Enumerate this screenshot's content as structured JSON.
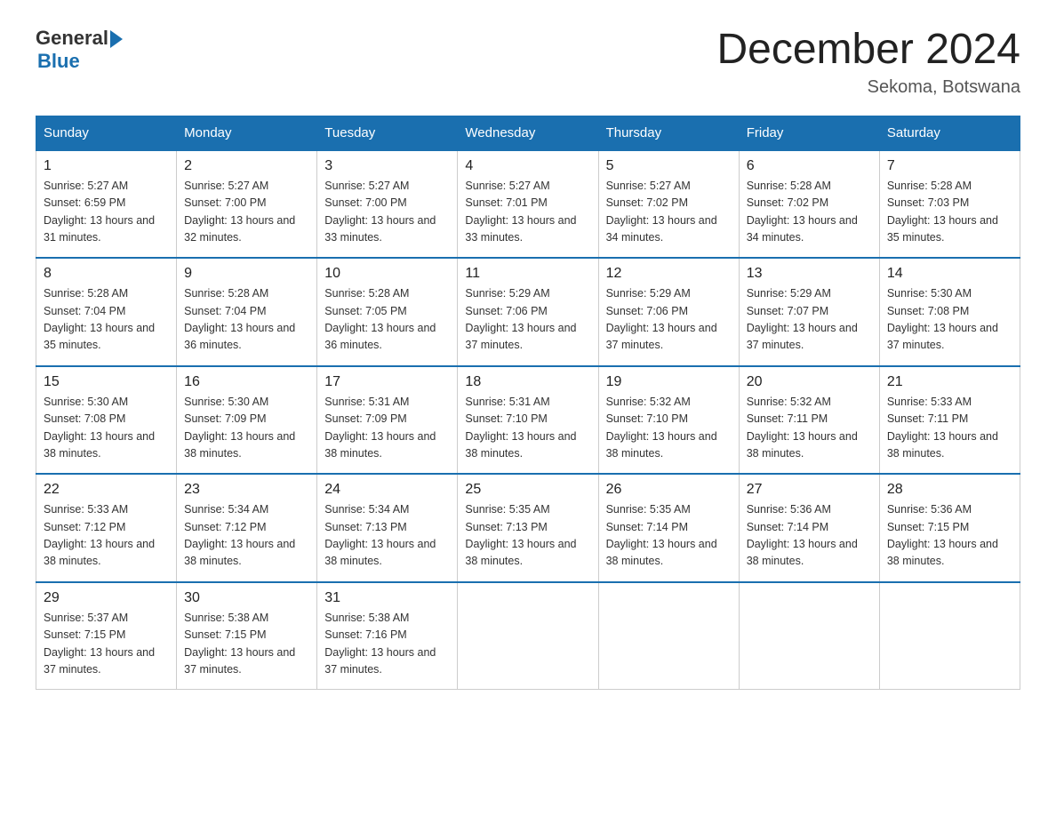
{
  "logo": {
    "text_general": "General",
    "text_blue": "Blue"
  },
  "title": "December 2024",
  "subtitle": "Sekoma, Botswana",
  "headers": [
    "Sunday",
    "Monday",
    "Tuesday",
    "Wednesday",
    "Thursday",
    "Friday",
    "Saturday"
  ],
  "weeks": [
    [
      {
        "day": "1",
        "sunrise": "5:27 AM",
        "sunset": "6:59 PM",
        "daylight": "13 hours and 31 minutes."
      },
      {
        "day": "2",
        "sunrise": "5:27 AM",
        "sunset": "7:00 PM",
        "daylight": "13 hours and 32 minutes."
      },
      {
        "day": "3",
        "sunrise": "5:27 AM",
        "sunset": "7:00 PM",
        "daylight": "13 hours and 33 minutes."
      },
      {
        "day": "4",
        "sunrise": "5:27 AM",
        "sunset": "7:01 PM",
        "daylight": "13 hours and 33 minutes."
      },
      {
        "day": "5",
        "sunrise": "5:27 AM",
        "sunset": "7:02 PM",
        "daylight": "13 hours and 34 minutes."
      },
      {
        "day": "6",
        "sunrise": "5:28 AM",
        "sunset": "7:02 PM",
        "daylight": "13 hours and 34 minutes."
      },
      {
        "day": "7",
        "sunrise": "5:28 AM",
        "sunset": "7:03 PM",
        "daylight": "13 hours and 35 minutes."
      }
    ],
    [
      {
        "day": "8",
        "sunrise": "5:28 AM",
        "sunset": "7:04 PM",
        "daylight": "13 hours and 35 minutes."
      },
      {
        "day": "9",
        "sunrise": "5:28 AM",
        "sunset": "7:04 PM",
        "daylight": "13 hours and 36 minutes."
      },
      {
        "day": "10",
        "sunrise": "5:28 AM",
        "sunset": "7:05 PM",
        "daylight": "13 hours and 36 minutes."
      },
      {
        "day": "11",
        "sunrise": "5:29 AM",
        "sunset": "7:06 PM",
        "daylight": "13 hours and 37 minutes."
      },
      {
        "day": "12",
        "sunrise": "5:29 AM",
        "sunset": "7:06 PM",
        "daylight": "13 hours and 37 minutes."
      },
      {
        "day": "13",
        "sunrise": "5:29 AM",
        "sunset": "7:07 PM",
        "daylight": "13 hours and 37 minutes."
      },
      {
        "day": "14",
        "sunrise": "5:30 AM",
        "sunset": "7:08 PM",
        "daylight": "13 hours and 37 minutes."
      }
    ],
    [
      {
        "day": "15",
        "sunrise": "5:30 AM",
        "sunset": "7:08 PM",
        "daylight": "13 hours and 38 minutes."
      },
      {
        "day": "16",
        "sunrise": "5:30 AM",
        "sunset": "7:09 PM",
        "daylight": "13 hours and 38 minutes."
      },
      {
        "day": "17",
        "sunrise": "5:31 AM",
        "sunset": "7:09 PM",
        "daylight": "13 hours and 38 minutes."
      },
      {
        "day": "18",
        "sunrise": "5:31 AM",
        "sunset": "7:10 PM",
        "daylight": "13 hours and 38 minutes."
      },
      {
        "day": "19",
        "sunrise": "5:32 AM",
        "sunset": "7:10 PM",
        "daylight": "13 hours and 38 minutes."
      },
      {
        "day": "20",
        "sunrise": "5:32 AM",
        "sunset": "7:11 PM",
        "daylight": "13 hours and 38 minutes."
      },
      {
        "day": "21",
        "sunrise": "5:33 AM",
        "sunset": "7:11 PM",
        "daylight": "13 hours and 38 minutes."
      }
    ],
    [
      {
        "day": "22",
        "sunrise": "5:33 AM",
        "sunset": "7:12 PM",
        "daylight": "13 hours and 38 minutes."
      },
      {
        "day": "23",
        "sunrise": "5:34 AM",
        "sunset": "7:12 PM",
        "daylight": "13 hours and 38 minutes."
      },
      {
        "day": "24",
        "sunrise": "5:34 AM",
        "sunset": "7:13 PM",
        "daylight": "13 hours and 38 minutes."
      },
      {
        "day": "25",
        "sunrise": "5:35 AM",
        "sunset": "7:13 PM",
        "daylight": "13 hours and 38 minutes."
      },
      {
        "day": "26",
        "sunrise": "5:35 AM",
        "sunset": "7:14 PM",
        "daylight": "13 hours and 38 minutes."
      },
      {
        "day": "27",
        "sunrise": "5:36 AM",
        "sunset": "7:14 PM",
        "daylight": "13 hours and 38 minutes."
      },
      {
        "day": "28",
        "sunrise": "5:36 AM",
        "sunset": "7:15 PM",
        "daylight": "13 hours and 38 minutes."
      }
    ],
    [
      {
        "day": "29",
        "sunrise": "5:37 AM",
        "sunset": "7:15 PM",
        "daylight": "13 hours and 37 minutes."
      },
      {
        "day": "30",
        "sunrise": "5:38 AM",
        "sunset": "7:15 PM",
        "daylight": "13 hours and 37 minutes."
      },
      {
        "day": "31",
        "sunrise": "5:38 AM",
        "sunset": "7:16 PM",
        "daylight": "13 hours and 37 minutes."
      },
      null,
      null,
      null,
      null
    ]
  ]
}
